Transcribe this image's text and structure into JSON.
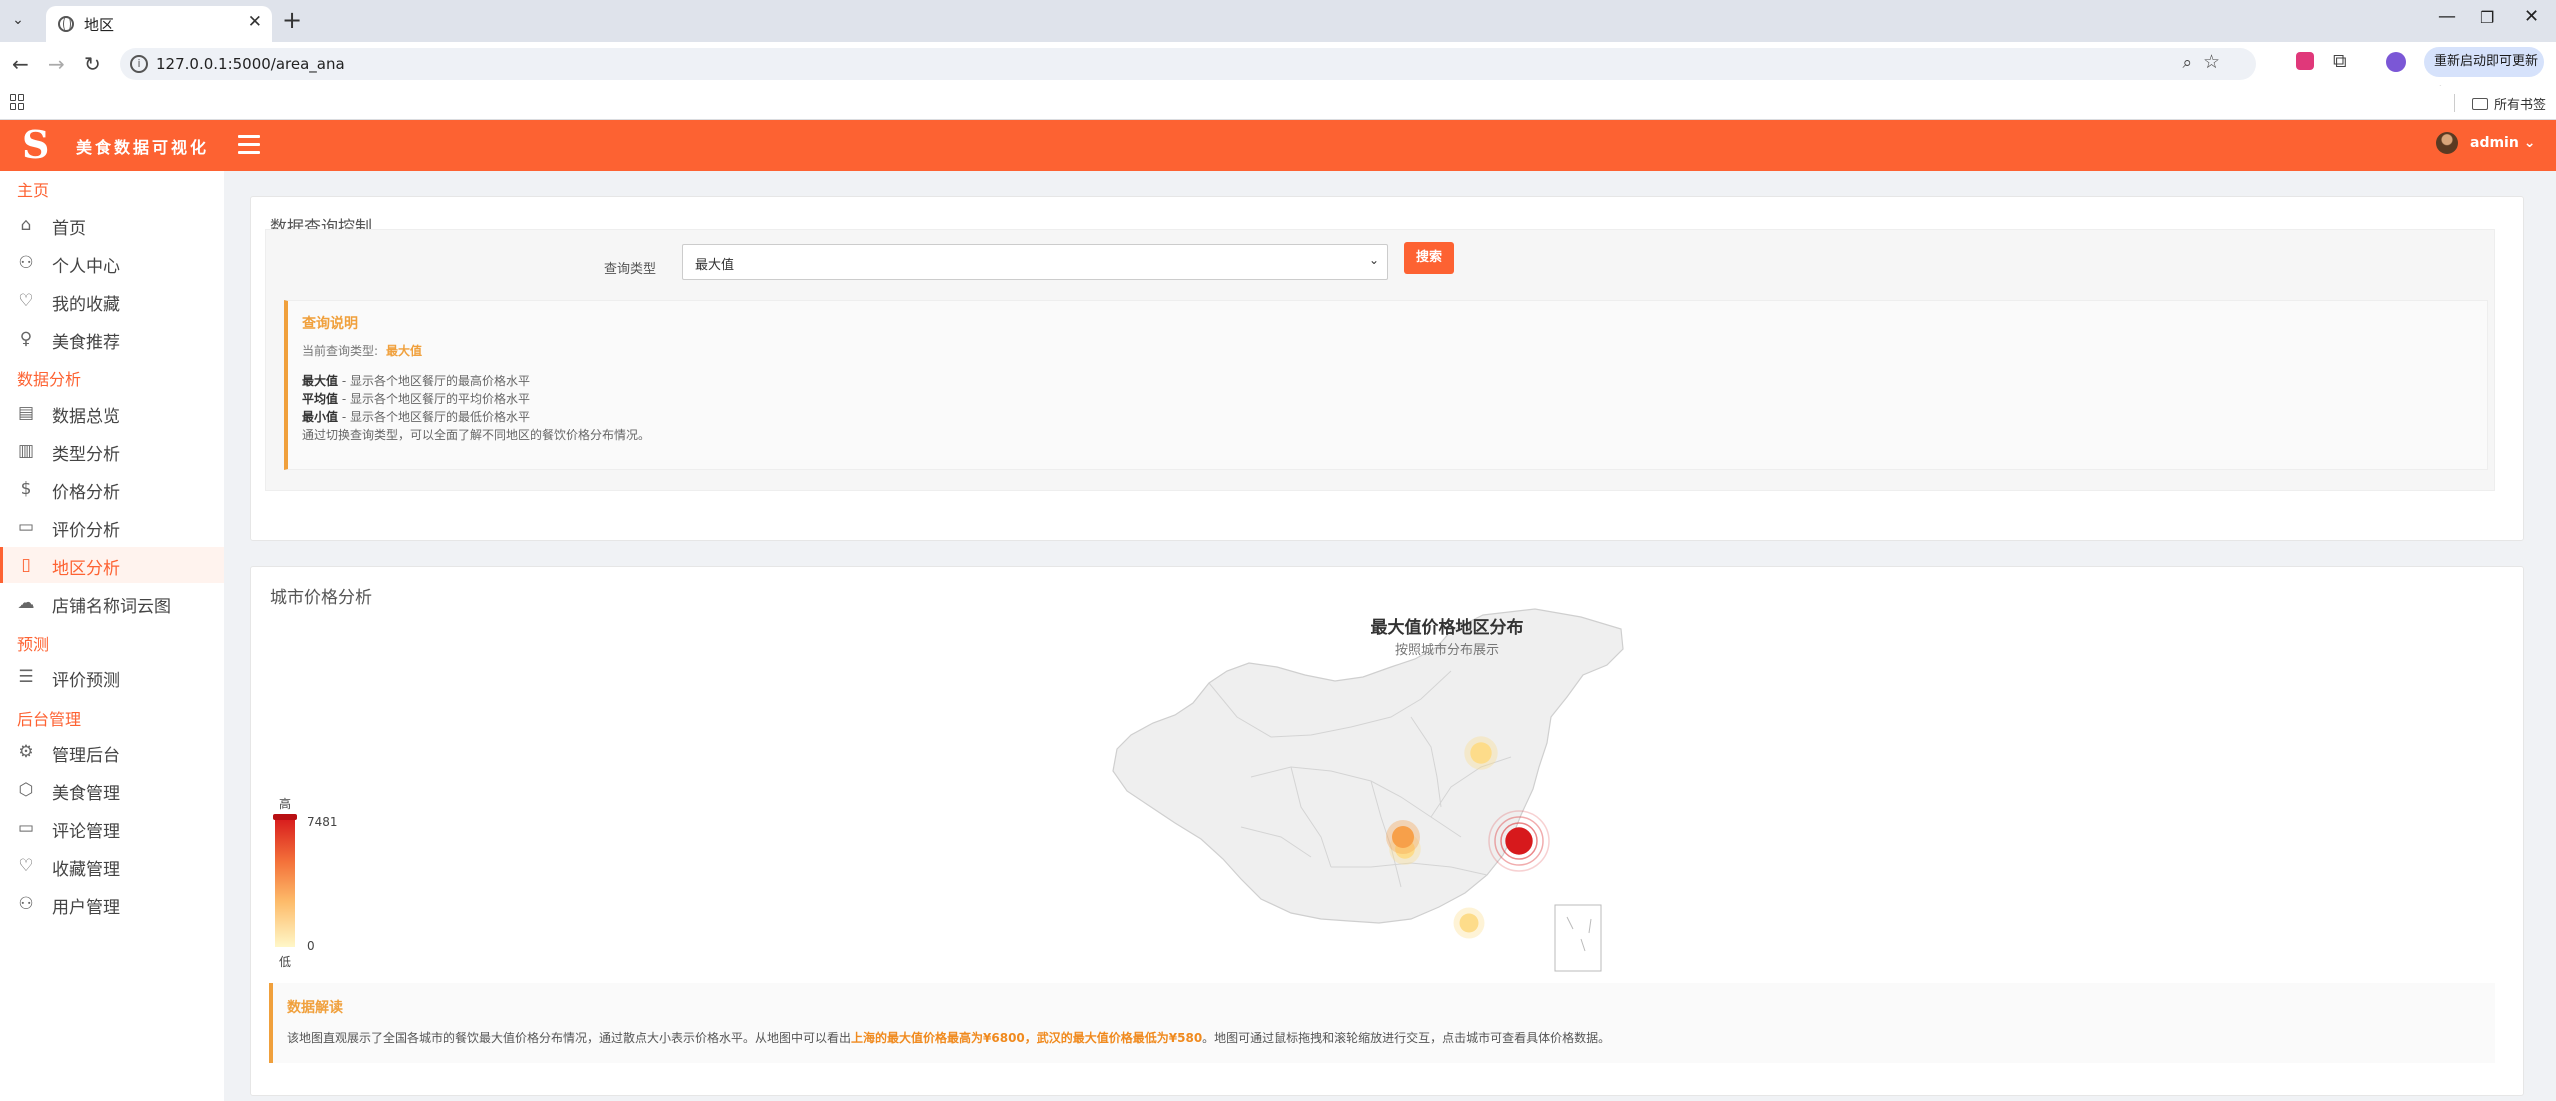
{
  "browser": {
    "tab_title": "地区",
    "url": "127.0.0.1:5000/area_ana",
    "update_button": "重新启动即可更新",
    "all_bookmarks": "所有书签"
  },
  "header": {
    "logo_letter": "S",
    "brand": "美食数据可视化",
    "user": "admin"
  },
  "sidebar": {
    "sections": [
      {
        "title": "主页",
        "items": [
          {
            "label": "首页",
            "icon": "home-icon"
          },
          {
            "label": "个人中心",
            "icon": "user-icon"
          },
          {
            "label": "我的收藏",
            "icon": "heart-icon"
          },
          {
            "label": "美食推荐",
            "icon": "bulb-icon"
          }
        ]
      },
      {
        "title": "数据分析",
        "items": [
          {
            "label": "数据总览",
            "icon": "layout-icon"
          },
          {
            "label": "类型分析",
            "icon": "chart-icon"
          },
          {
            "label": "价格分析",
            "icon": "dollar-icon"
          },
          {
            "label": "评价分析",
            "icon": "comment-icon"
          },
          {
            "label": "地区分析",
            "icon": "map-icon"
          },
          {
            "label": "店铺名称词云图",
            "icon": "cloud-icon"
          }
        ]
      },
      {
        "title": "预测",
        "items": [
          {
            "label": "评价预测",
            "icon": "list-icon"
          }
        ]
      },
      {
        "title": "后台管理",
        "items": [
          {
            "label": "管理后台",
            "icon": "gear-icon"
          },
          {
            "label": "美食管理",
            "icon": "box-icon"
          },
          {
            "label": "评论管理",
            "icon": "message-icon"
          },
          {
            "label": "收藏管理",
            "icon": "heart-hands-icon"
          },
          {
            "label": "用户管理",
            "icon": "user-manage-icon"
          }
        ]
      }
    ],
    "active": "地区分析"
  },
  "query": {
    "card_title": "数据查询控制",
    "label": "查询类型",
    "selected": "最大值",
    "search_button": "搜索",
    "explain_title": "查询说明",
    "current_prefix": "当前查询类型:",
    "current_value": "最大值",
    "lines": [
      {
        "term": "最大值",
        "desc": " - 显示各个地区餐厅的最高价格水平"
      },
      {
        "term": "平均值",
        "desc": " - 显示各个地区餐厅的平均价格水平"
      },
      {
        "term": "最小值",
        "desc": " - 显示各个地区餐厅的最低价格水平"
      }
    ],
    "note": "通过切换查询类型，可以全面了解不同地区的餐饮价格分布情况。"
  },
  "map": {
    "card_title": "城市价格分析",
    "title": "最大值价格地区分布",
    "subtitle": "按照城市分布展示",
    "legend": {
      "high": "高",
      "low": "低",
      "max": "7481",
      "min": "0"
    },
    "colors": {
      "high": "#d7191c",
      "mid": "#f4733b",
      "low": "#fff7c8"
    },
    "chart_data": {
      "type": "scatter",
      "title": "最大值价格地区分布",
      "subtitle": "按照城市分布展示",
      "value_range": [
        0,
        7481
      ],
      "points": [
        {
          "level": 0.95
        },
        {
          "level": 0.45
        },
        {
          "level": 0.3
        },
        {
          "level": 0.25
        },
        {
          "level": 0.5
        }
      ]
    },
    "interp_title": "数据解读",
    "interp_before": "该地图直观展示了全国各城市的餐饮最大值价格分布情况，通过散点大小表示价格水平。从地图中可以看出",
    "interp_highlight": "上海的最大值价格最高为¥6800，武汉的最大值价格最低为¥580",
    "interp_after": "。地图可通过鼠标拖拽和滚轮缩放进行交互，点击城市可查看具体价格数据。"
  }
}
